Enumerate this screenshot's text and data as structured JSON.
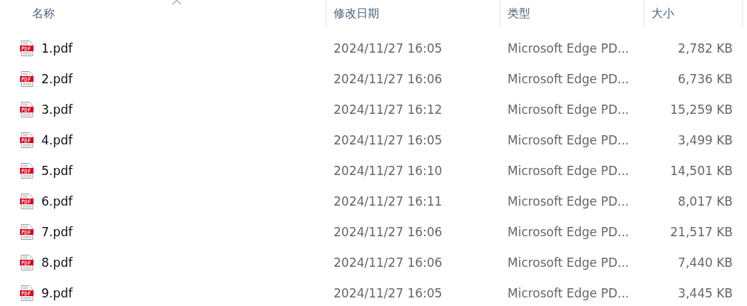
{
  "columns": [
    "名称",
    "修改日期",
    "类型",
    "大小"
  ],
  "rows": [
    {
      "name": "1.pdf",
      "modified": "2024/11/27 16:05",
      "type": "Microsoft Edge PD...",
      "size": "2,782 KB"
    },
    {
      "name": "2.pdf",
      "modified": "2024/11/27 16:06",
      "type": "Microsoft Edge PD...",
      "size": "6,736 KB"
    },
    {
      "name": "3.pdf",
      "modified": "2024/11/27 16:12",
      "type": "Microsoft Edge PD...",
      "size": "15,259 KB"
    },
    {
      "name": "4.pdf",
      "modified": "2024/11/27 16:05",
      "type": "Microsoft Edge PD...",
      "size": "3,499 KB"
    },
    {
      "name": "5.pdf",
      "modified": "2024/11/27 16:10",
      "type": "Microsoft Edge PD...",
      "size": "14,501 KB"
    },
    {
      "name": "6.pdf",
      "modified": "2024/11/27 16:11",
      "type": "Microsoft Edge PD...",
      "size": "8,017 KB"
    },
    {
      "name": "7.pdf",
      "modified": "2024/11/27 16:06",
      "type": "Microsoft Edge PD...",
      "size": "21,517 KB"
    },
    {
      "name": "8.pdf",
      "modified": "2024/11/27 16:06",
      "type": "Microsoft Edge PD...",
      "size": "7,440 KB"
    },
    {
      "name": "9.pdf",
      "modified": "2024/11/27 16:05",
      "type": "Microsoft Edge PD...",
      "size": "3,445 KB"
    }
  ]
}
